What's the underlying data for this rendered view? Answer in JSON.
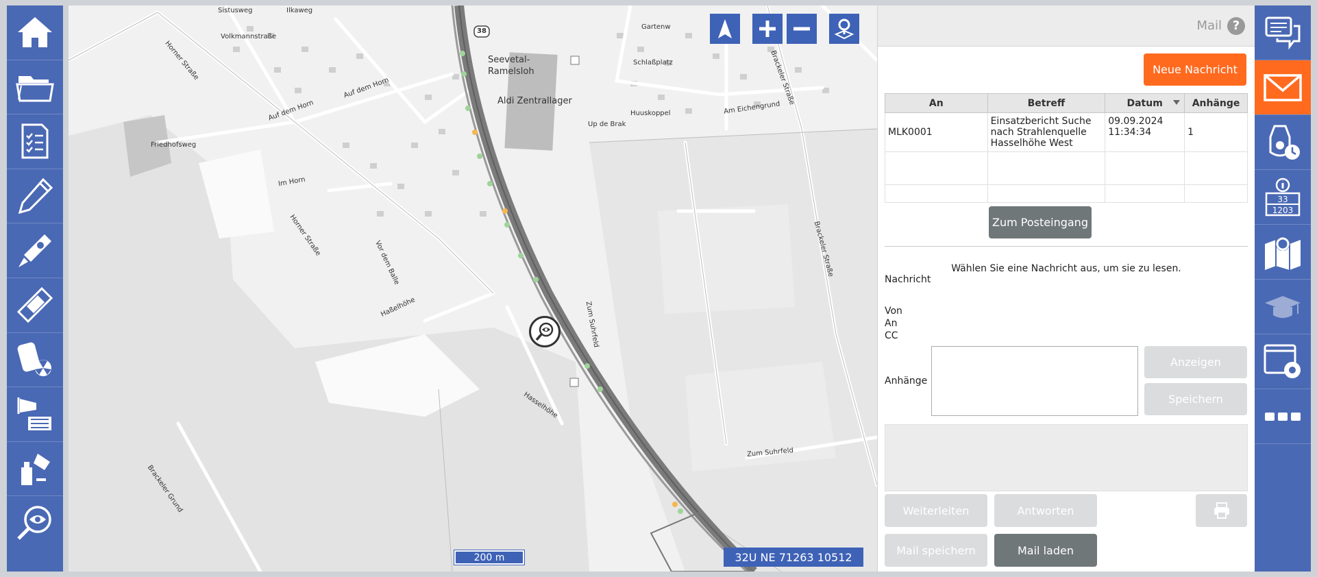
{
  "map": {
    "scale_label": "200 m",
    "coordinates": "32U NE 71263 10512",
    "labels": [
      {
        "text": "Sistusweg",
        "cls": ""
      },
      {
        "text": "Ilkaweg",
        "cls": ""
      },
      {
        "text": "Volkmannstraße",
        "cls": ""
      },
      {
        "text": "Seevetal-",
        "cls": "big"
      },
      {
        "text": "Ramelsloh",
        "cls": "big"
      },
      {
        "text": "Aldi Zentrallager",
        "cls": "big"
      },
      {
        "text": "Auf dem Horn",
        "cls": ""
      },
      {
        "text": "Auf dem Horn",
        "cls": ""
      },
      {
        "text": "Friedhofsweg",
        "cls": ""
      },
      {
        "text": "Im Horn",
        "cls": ""
      },
      {
        "text": "Horner Straße",
        "cls": ""
      },
      {
        "text": "Horner Straße",
        "cls": ""
      },
      {
        "text": "Vor dem Balle",
        "cls": ""
      },
      {
        "text": "Haßelhöhe",
        "cls": ""
      },
      {
        "text": "Hasselhöhe",
        "cls": ""
      },
      {
        "text": "Zum Suhrfeld",
        "cls": ""
      },
      {
        "text": "Zum Suhrfeld",
        "cls": ""
      },
      {
        "text": "Schlaßplatz",
        "cls": ""
      },
      {
        "text": "Gartenw",
        "cls": ""
      },
      {
        "text": "Huuskoppel",
        "cls": ""
      },
      {
        "text": "Up de Brak",
        "cls": ""
      },
      {
        "text": "Am Eichengrund",
        "cls": ""
      },
      {
        "text": "Brackeler Straße",
        "cls": ""
      },
      {
        "text": "Brackeler Straße",
        "cls": ""
      },
      {
        "text": "Brackeler Grund",
        "cls": ""
      },
      {
        "text": "38",
        "cls": ""
      }
    ]
  },
  "mail": {
    "title": "Mail",
    "new_message": "Neue Nachricht",
    "table": {
      "headers": [
        "An",
        "Betreff",
        "Datum",
        "Anhänge"
      ],
      "rows": [
        {
          "an": "MLK0001",
          "betreff": "Einsatzbericht Suche nach Strahlenquelle Hasselhöhe West",
          "datum": "09.09.2024 11:34:34",
          "anhaenge": "1"
        }
      ]
    },
    "inbox_button": "Zum Posteingang",
    "hint": "Wählen Sie eine Nachricht aus, um sie zu lesen.",
    "label_nachricht": "Nachricht",
    "label_von": "Von",
    "label_an": "An",
    "label_cc": "CC",
    "label_anhaenge": "Anhänge",
    "btn_anzeigen": "Anzeigen",
    "btn_speichern": "Speichern",
    "btn_weiterleiten": "Weiterleiten",
    "btn_antworten": "Antworten",
    "btn_mail_speichern": "Mail speichern",
    "btn_mail_laden": "Mail laden"
  },
  "right_info": {
    "line1": "33",
    "line2": "1203"
  },
  "colors": {
    "accent": "#4a69b4",
    "orange": "#ff6a1f",
    "map_button": "#3e62b6"
  }
}
